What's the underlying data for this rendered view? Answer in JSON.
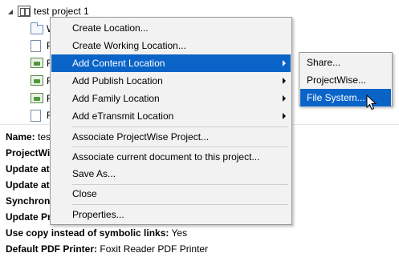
{
  "tree": {
    "root_label": "test project 1",
    "children": [
      {
        "label": "W",
        "icon": "folder-icon"
      },
      {
        "label": "P",
        "icon": "document-icon"
      },
      {
        "label": "F",
        "icon": "content-location-icon"
      },
      {
        "label": "F",
        "icon": "content-location-icon"
      },
      {
        "label": "F",
        "icon": "content-location-icon"
      },
      {
        "label": "F",
        "icon": "content-location-icon"
      },
      {
        "label": "F",
        "icon": "document-icon"
      }
    ]
  },
  "properties": [
    {
      "key": "Name:",
      "value": "tes"
    },
    {
      "key": "ProjectWis",
      "value": ""
    },
    {
      "key": "Update at",
      "value": ""
    },
    {
      "key": "Update at",
      "value": ""
    },
    {
      "key": "Synchroni",
      "value": ""
    },
    {
      "key": "Update Pr",
      "value": ""
    },
    {
      "key": "Use copy instead of symbolic links:",
      "value": "Yes"
    },
    {
      "key": "Default PDF Printer:",
      "value": "Foxit Reader PDF Printer"
    }
  ],
  "context_menu": {
    "items": [
      "Create Location...",
      "Create Working Location...",
      "Add Content Location",
      "Add Publish Location",
      "Add Family Location",
      "Add eTransmit Location",
      "Associate ProjectWise Project...",
      "Associate current document to this project...",
      "Save As...",
      "Close",
      "Properties..."
    ]
  },
  "submenu": {
    "items": [
      "Share...",
      "ProjectWise...",
      "File System..."
    ]
  },
  "colors": {
    "highlight": "#0a64c8",
    "menu_bg": "#f2f2f2"
  }
}
